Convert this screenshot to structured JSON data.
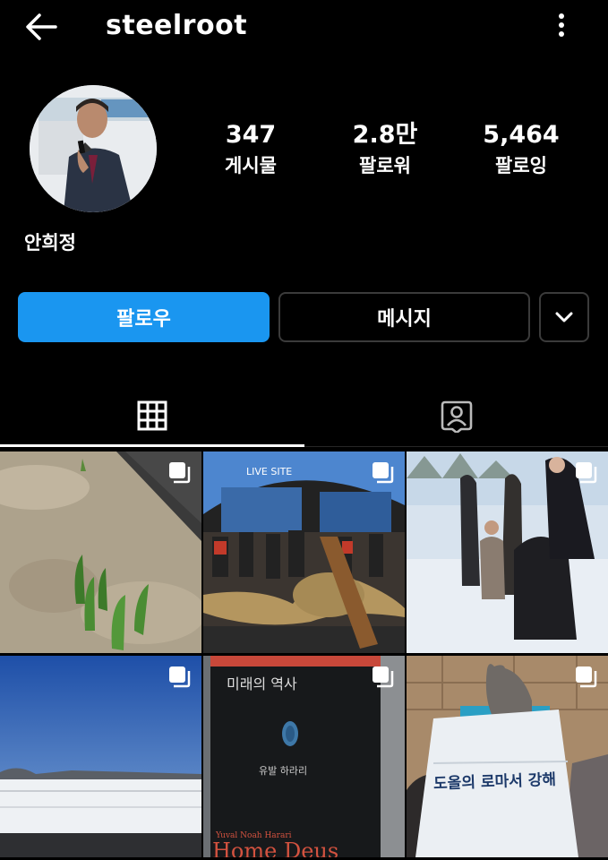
{
  "header": {
    "username": "steelroot",
    "back_icon": "arrow-left-icon",
    "more_icon": "vertical-dots-icon"
  },
  "profile": {
    "name": "안희정",
    "stats": [
      {
        "value": "347",
        "label": "게시물"
      },
      {
        "value": "2.8만",
        "label": "팔로워"
      },
      {
        "value": "5,464",
        "label": "팔로잉"
      }
    ]
  },
  "actions": {
    "follow_label": "팔로우",
    "message_label": "메시지",
    "dropdown_icon": "chevron-down-icon",
    "accent": "#1a96f0"
  },
  "tabs": [
    {
      "icon": "grid-icon",
      "active": true
    },
    {
      "icon": "tagged-person-icon",
      "active": false
    }
  ],
  "posts": [
    {
      "subject": "sprouts in soil",
      "multiple": true
    },
    {
      "subject": "straw rope ceremony at LIVE SITE",
      "multiple": true,
      "sign_text": "LIVE SITE"
    },
    {
      "subject": "people in snow",
      "multiple": true
    },
    {
      "subject": "snowy field under blue sky",
      "multiple": true
    },
    {
      "subject": "book cover",
      "multiple": true,
      "title_text": "미래의 역사",
      "author_text": "유발 하라리",
      "footer_text": "Home Deus",
      "author_en": "Yuval Noah Harari"
    },
    {
      "subject": "book with cat",
      "multiple": true,
      "title_text": "도올의 로마서 강해"
    }
  ]
}
